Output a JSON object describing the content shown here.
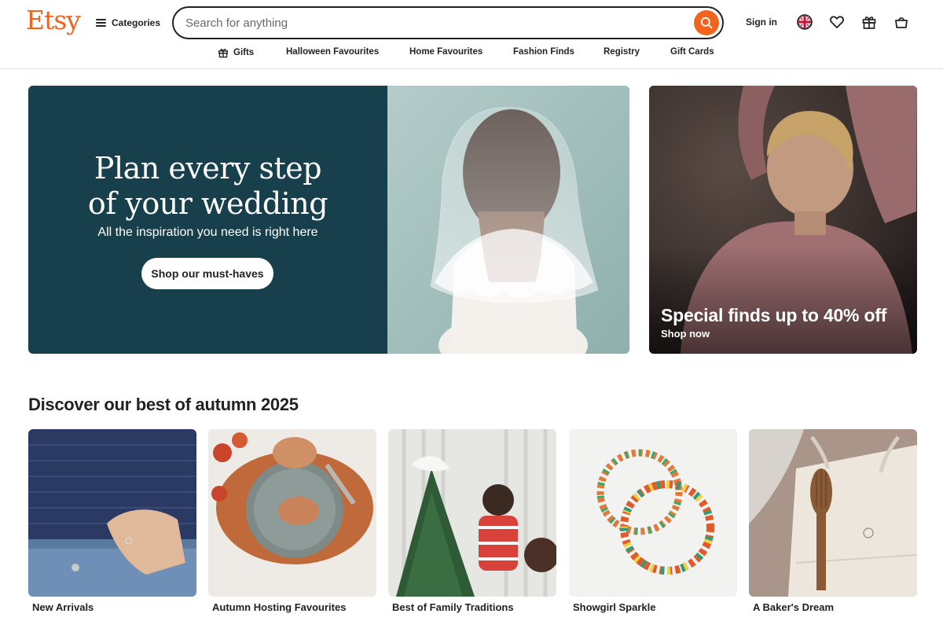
{
  "header": {
    "logo": "Etsy",
    "categories_label": "Categories",
    "search_placeholder": "Search for anything",
    "signin_label": "Sign in"
  },
  "subnav": {
    "items": [
      {
        "label": "Gifts",
        "icon": "gift-icon"
      },
      {
        "label": "Halloween Favourites"
      },
      {
        "label": "Home Favourites"
      },
      {
        "label": "Fashion Finds"
      },
      {
        "label": "Registry"
      },
      {
        "label": "Gift Cards"
      }
    ]
  },
  "hero": {
    "title_line1": "Plan every step",
    "title_line2": "of your wedding",
    "subtitle": "All the inspiration you need is right here",
    "button_label": "Shop our must-haves",
    "bg_color": "#183f4c"
  },
  "promo": {
    "title": "Special finds up to 40% off",
    "subtitle": "Shop now"
  },
  "section": {
    "title": "Discover our best of autumn 2025",
    "cards": [
      {
        "label": "New Arrivals"
      },
      {
        "label": "Autumn Hosting Favourites"
      },
      {
        "label": "Best of Family Traditions"
      },
      {
        "label": "Showgirl Sparkle"
      },
      {
        "label": "A Baker's Dream"
      }
    ]
  },
  "colors": {
    "brand": "#f1641e",
    "text": "#222222"
  }
}
